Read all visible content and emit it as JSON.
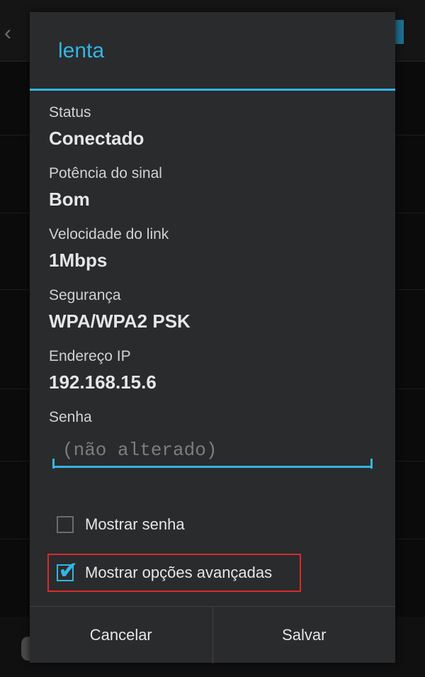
{
  "dialog": {
    "title": "lenta",
    "fields": [
      {
        "label": "Status",
        "value": "Conectado"
      },
      {
        "label": "Potência do sinal",
        "value": "Bom"
      },
      {
        "label": "Velocidade do link",
        "value": "1Mbps"
      },
      {
        "label": "Segurança",
        "value": "WPA/WPA2 PSK"
      },
      {
        "label": "Endereço IP",
        "value": "192.168.15.6"
      }
    ],
    "password": {
      "label": "Senha",
      "placeholder": "(não alterado)",
      "value": ""
    },
    "show_password": {
      "label": "Mostrar senha",
      "checked": false
    },
    "show_advanced": {
      "label": "Mostrar opções avançadas",
      "checked": true
    },
    "buttons": {
      "cancel": "Cancelar",
      "save": "Salvar"
    }
  },
  "colors": {
    "accent": "#33b5e5",
    "dialog_bg": "#2a2b2d",
    "highlight": "#d92b2b"
  },
  "icons": {
    "back": "chevron-left-icon",
    "checkmark": "checkmark-icon"
  }
}
